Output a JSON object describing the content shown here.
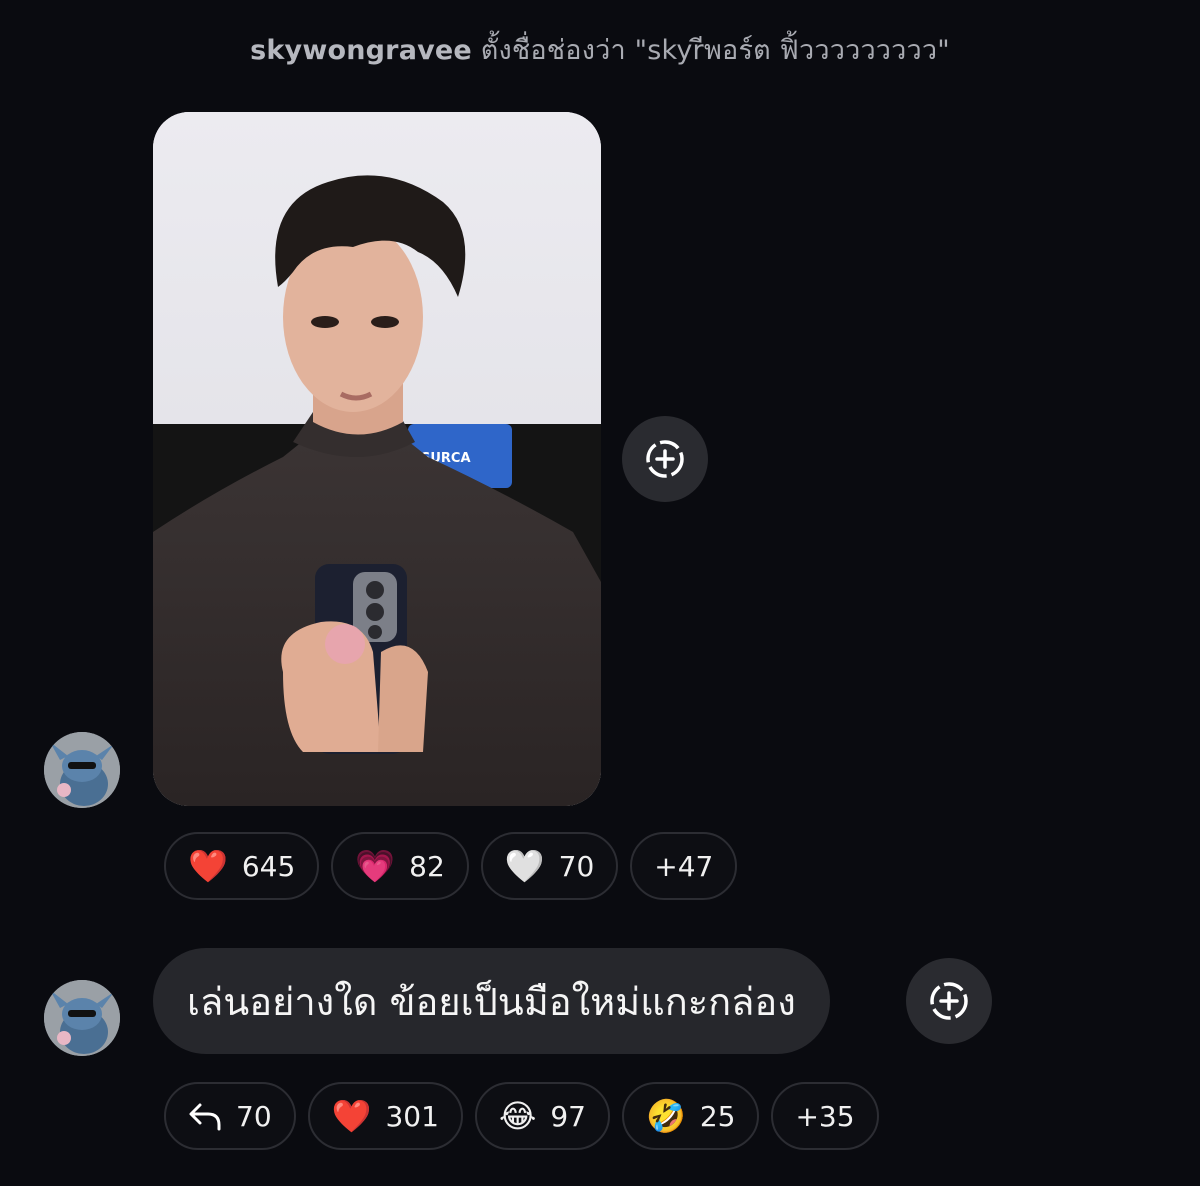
{
  "system_notice": {
    "username": "skywongravee",
    "action_text": " ตั้งชื่อช่องว่า \"skyrีพอร์ต ฟิ้ววววววววว\""
  },
  "message_photo": {
    "photo_label_text": "SURCA",
    "reactions": [
      {
        "icon": "red-heart",
        "emoji": "❤️",
        "count": "645"
      },
      {
        "icon": "sparkling-heart",
        "emoji": "💗",
        "count": "82"
      },
      {
        "icon": "white-heart",
        "emoji": "🤍",
        "count": "70"
      },
      {
        "icon": "more",
        "emoji": "",
        "count": "+47"
      }
    ]
  },
  "message_text": {
    "text": "เล่นอย่างใด ข้อยเป็นมือใหม่แกะกล่อง",
    "reactions": [
      {
        "icon": "reply-arrow",
        "emoji": "↰",
        "count": "70"
      },
      {
        "icon": "red-heart",
        "emoji": "❤️",
        "count": "301"
      },
      {
        "icon": "tears-of-joy",
        "emoji": "😂",
        "count": "97"
      },
      {
        "icon": "rolling-laughing",
        "emoji": "🤣",
        "count": "25"
      },
      {
        "icon": "more",
        "emoji": "",
        "count": "+35"
      }
    ]
  },
  "colors": {
    "background": "#0a0b10",
    "bubble": "#26272c",
    "pill_border": "#2c2d33",
    "notice_text": "#a9abb2"
  }
}
